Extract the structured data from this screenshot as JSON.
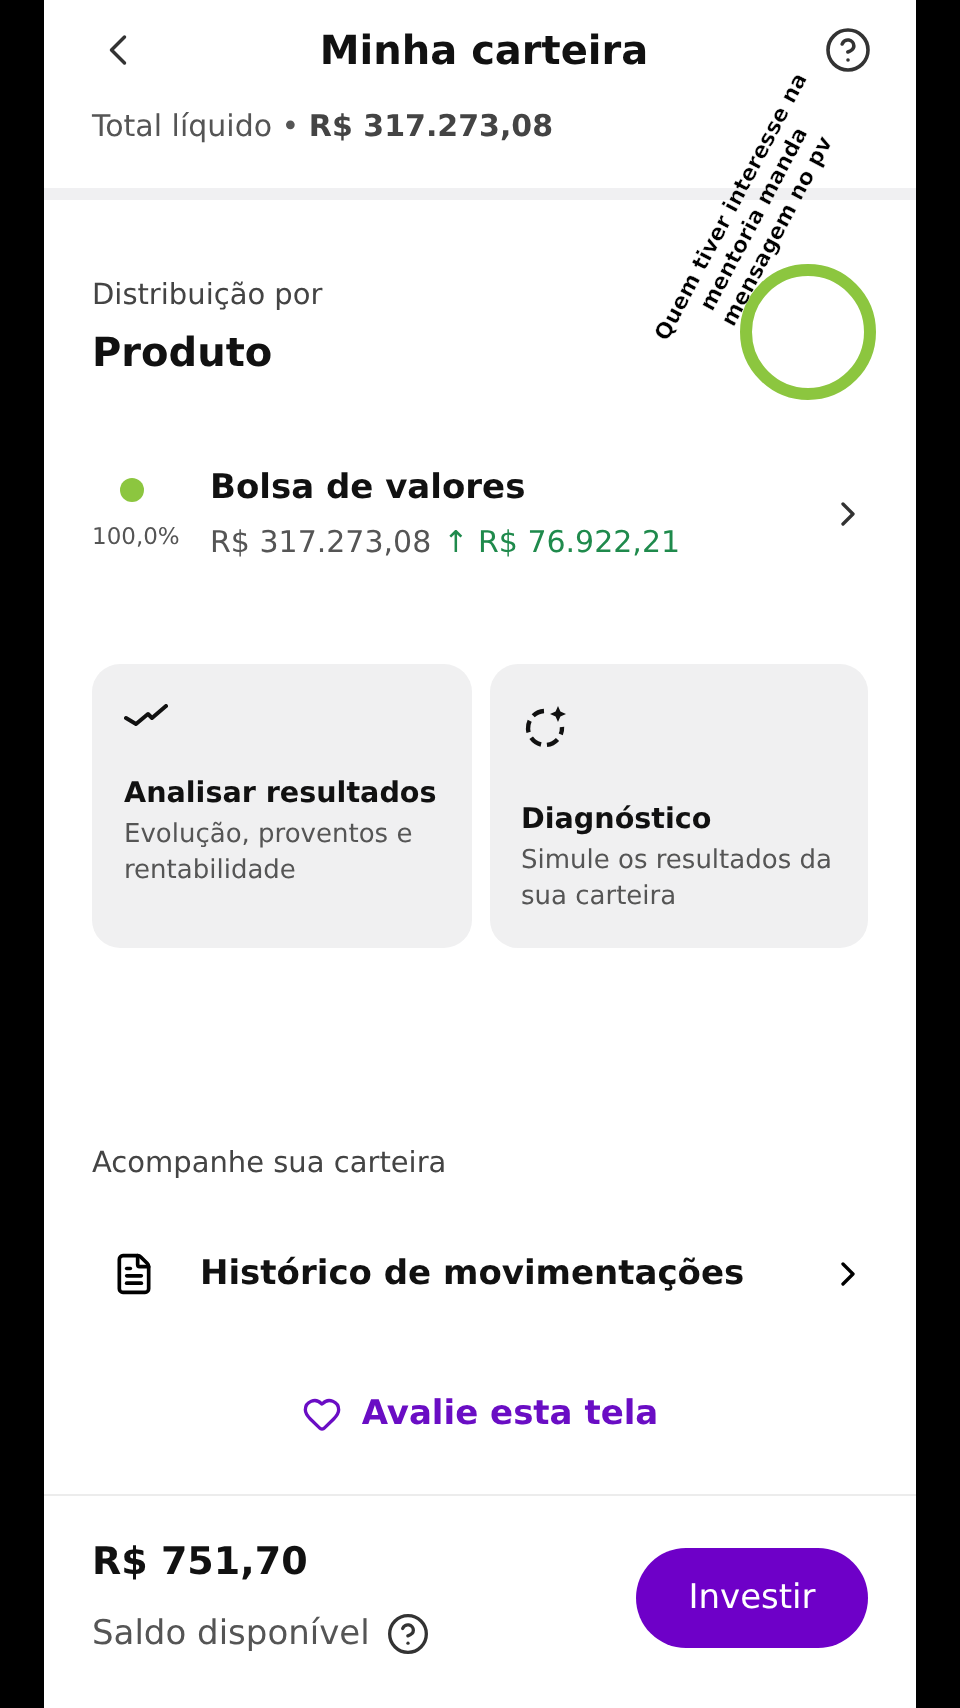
{
  "header": {
    "title": "Minha carteira",
    "total": "Total líquido • **R$ 317.273,08**"
  },
  "distribution": {
    "label": "Distribuição por",
    "title": "Produto",
    "items": [
      {
        "name": "Bolsa de valores",
        "percent": "100,0%",
        "value": "R$ 317.273,08",
        "gain": "↑ R$ 76.922,21",
        "color": "#8cc63f",
        "level": 1
      }
    ]
  },
  "cards": [
    {
      "kind": "trend",
      "title": "Analisar resultados",
      "subtitle": "Evolução, proventos e rentabilidade"
    },
    {
      "kind": "diagnostic",
      "title": "Diagnóstico",
      "subtitle": "Simule os resultados da sua carteira"
    }
  ],
  "follow": {
    "heading": "Acompanhe sua carteira",
    "items": [
      {
        "label": "Histórico de movimentações"
      }
    ]
  },
  "rate_link": "Avalie esta tela",
  "footer": {
    "balance": "R$ 751,70",
    "label": "Saldo disponível",
    "button": "Investir"
  },
  "overlay_note": "Quem tiver interesse na mentoria manda mensagem no pv"
}
